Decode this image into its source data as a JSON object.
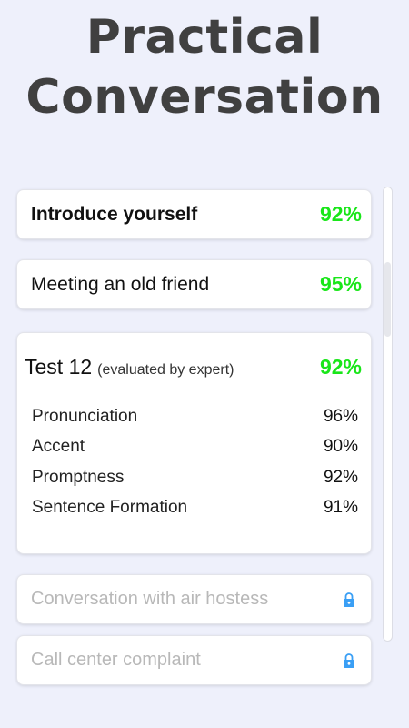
{
  "title": {
    "line1": "Practical",
    "line2": "Conversation"
  },
  "lessons": [
    {
      "label": "Introduce yourself",
      "score": "92%"
    },
    {
      "label": "Meeting an old friend",
      "score": "95%"
    }
  ],
  "test": {
    "title": "Test 12",
    "note": "(evaluated by expert)",
    "score": "92%",
    "metrics": [
      {
        "label": "Pronunciation",
        "value": "96%"
      },
      {
        "label": "Accent",
        "value": "90%"
      },
      {
        "label": "Promptness",
        "value": "92%"
      },
      {
        "label": "Sentence Formation",
        "value": "91%"
      }
    ]
  },
  "locked_lessons": [
    {
      "label": "Conversation with air hostess",
      "icon": "lock-icon"
    },
    {
      "label": "Call center complaint",
      "icon": "lock-icon"
    }
  ],
  "colors": {
    "score_green": "#19e619",
    "background": "#eef0fb",
    "lock_blue": "#3a9ff5"
  }
}
